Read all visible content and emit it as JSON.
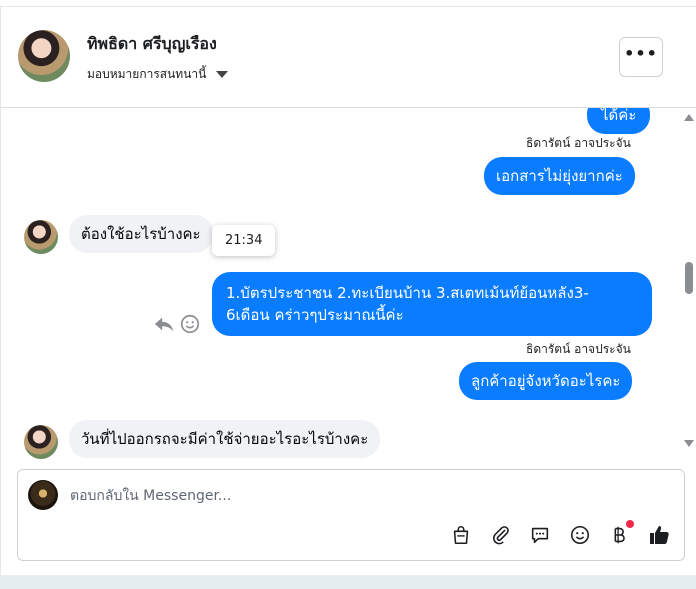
{
  "header": {
    "contact_name": "ทิพธิดา ศรีบุญเรือง",
    "assign_label": "มอบหมายการสนทนานี้",
    "more_label": "•••"
  },
  "messages": [
    {
      "direction": "out",
      "text": "ได้ค่ะ"
    },
    {
      "sender": "ธิดารัตน์ อาจประจัน"
    },
    {
      "direction": "out",
      "text": "เอกสารไม่ยุ่งยากค่ะ"
    },
    {
      "direction": "in",
      "text": "ต้องใช้อะไรบ้างคะ"
    },
    {
      "tooltip": "21:34"
    },
    {
      "direction": "out",
      "text_line1": "1.บัตรประชาชน 2.ทะเบียนบ้าน 3.สเตทเม้นท์ย้อนหลัง3-",
      "text_line2": "6เดือน คร่าวๆประมาณนี้ค่ะ"
    },
    {
      "sender": "ธิดารัตน์ อาจประจัน"
    },
    {
      "direction": "out",
      "text": "ลูกค้าอยู่จังหวัดอะไรคะ"
    },
    {
      "direction": "in",
      "text": "วันที่ไปออกรถจะมีค่าใช้จ่ายอะไรอะไรบ้างคะ"
    }
  ],
  "composer": {
    "placeholder": "ตอบกลับใน Messenger...",
    "tools": [
      "shopping-bag-icon",
      "paperclip-icon",
      "chat-bubble-icon",
      "smiley-icon",
      "baht-icon",
      "thumbs-up-icon"
    ]
  },
  "colors": {
    "outgoing_bubble": "#0a7cff",
    "incoming_bubble": "#f0f2f5",
    "notification_dot": "#f02849"
  }
}
